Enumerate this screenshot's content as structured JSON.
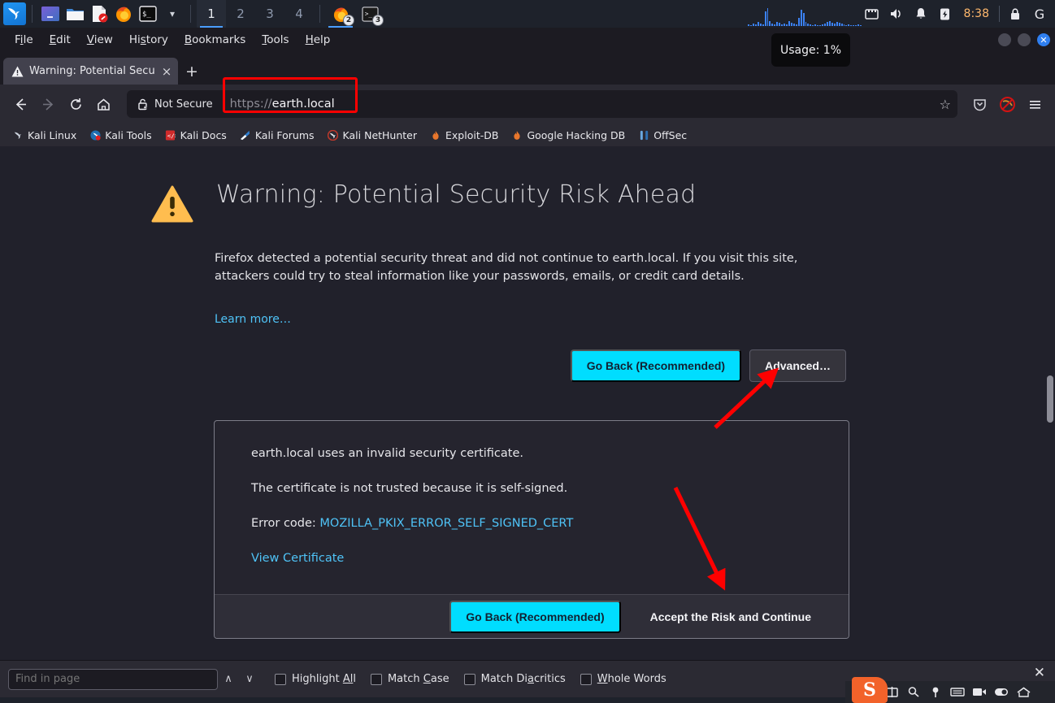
{
  "system_panel": {
    "launcher_icon": "kali-dragon-icon",
    "apps": [
      {
        "name": "app-icon-terminal-emulator",
        "icon": "purple-window-icon"
      },
      {
        "name": "app-icon-file-manager",
        "icon": "folder-icon"
      },
      {
        "name": "app-icon-text-editor",
        "icon": "document-icon"
      },
      {
        "name": "app-icon-firefox",
        "icon": "firefox-icon"
      },
      {
        "name": "app-icon-terminal",
        "icon": "terminal-icon"
      }
    ],
    "app_chevron": "chevron-down-icon",
    "workspaces": [
      "1",
      "2",
      "3",
      "4"
    ],
    "active_workspace": "1",
    "tasks": [
      {
        "name": "taskbar-firefox",
        "icon": "firefox-icon",
        "badge": "2",
        "active": true
      },
      {
        "name": "taskbar-terminal",
        "icon": "terminal-icon",
        "badge": "3",
        "active": false
      }
    ],
    "tray": [
      {
        "name": "network-icon",
        "glyph": "network"
      },
      {
        "name": "volume-icon",
        "glyph": "volume"
      },
      {
        "name": "notification-bell-icon",
        "glyph": "bell"
      },
      {
        "name": "battery-icon",
        "glyph": "battery"
      }
    ],
    "clock": "8:38",
    "lock_icon": "lock-icon",
    "session_icon": "g-icon",
    "network_graph_label": "network-activity-graph"
  },
  "tooltip": {
    "text": "Usage: 1%"
  },
  "browser": {
    "menubar": [
      {
        "name": "menu-file",
        "pre": "F",
        "accel": "i",
        "post": "le"
      },
      {
        "name": "menu-edit",
        "pre": "",
        "accel": "E",
        "post": "dit"
      },
      {
        "name": "menu-view",
        "pre": "",
        "accel": "V",
        "post": "iew"
      },
      {
        "name": "menu-history",
        "pre": "Hi",
        "accel": "s",
        "post": "tory"
      },
      {
        "name": "menu-bookmarks",
        "pre": "",
        "accel": "B",
        "post": "ookmarks"
      },
      {
        "name": "menu-tools",
        "pre": "",
        "accel": "T",
        "post": "ools"
      },
      {
        "name": "menu-help",
        "pre": "",
        "accel": "H",
        "post": "elp"
      }
    ],
    "window_controls": [
      "minimize",
      "maximize",
      "close"
    ],
    "tab": {
      "icon": "warning-triangle-icon",
      "title": "Warning: Potential Security Risk Ahead",
      "close_label": "×"
    },
    "new_tab_label": "+",
    "nav": {
      "back": "←",
      "forward": "→",
      "reload": "⟳",
      "home": "home-icon"
    },
    "urlbar": {
      "security_label": "Not Secure",
      "security_icon": "broken-lock-icon",
      "scheme": "https://",
      "host": "earth.local",
      "full_url": "https://earth.local",
      "bookmark_star": "☆",
      "highlight_color": "#ff0000"
    },
    "toolbar_right": [
      {
        "name": "pocket-icon",
        "glyph": "pocket"
      },
      {
        "name": "no-script-icon",
        "glyph": "noscript"
      },
      {
        "name": "app-menu-button",
        "glyph": "hamburger"
      }
    ],
    "bookmarks": [
      {
        "name": "bookmark-kali-linux",
        "label": "Kali Linux",
        "icon": "kali-dragon-icon",
        "color": "#4a90d9"
      },
      {
        "name": "bookmark-kali-tools",
        "label": "Kali Tools",
        "icon": "tools-icon",
        "color": "#1f6fb2"
      },
      {
        "name": "bookmark-kali-docs",
        "label": "Kali Docs",
        "icon": "docs-icon",
        "color": "#cf2b2b"
      },
      {
        "name": "bookmark-kali-forums",
        "label": "Kali Forums",
        "icon": "forums-icon",
        "color": "#2f7fd0"
      },
      {
        "name": "bookmark-kali-nethunter",
        "label": "Kali NetHunter",
        "icon": "nethunter-icon",
        "color": "#c0392b"
      },
      {
        "name": "bookmark-exploit-db",
        "label": "Exploit-DB",
        "icon": "flame-icon",
        "color": "#e8762c"
      },
      {
        "name": "bookmark-google-hacking-db",
        "label": "Google Hacking DB",
        "icon": "flame-icon",
        "color": "#e8762c"
      },
      {
        "name": "bookmark-offsec",
        "label": "OffSec",
        "icon": "offsec-icon",
        "color": "#4a90d9"
      }
    ]
  },
  "page": {
    "warning_icon": "warning-triangle-icon",
    "title": "Warning: Potential Security Risk Ahead",
    "body": "Firefox detected a potential security threat and did not continue to earth.local. If you visit this site, attackers could try to steal information like your passwords, emails, or credit card details.",
    "learn_more": "Learn more…",
    "go_back_label": "Go Back (Recommended)",
    "advanced_label": "Advanced…",
    "advanced_panel": {
      "line1": "earth.local uses an invalid security certificate.",
      "line2": "The certificate is not trusted because it is self-signed.",
      "error_prefix": "Error code: ",
      "error_code": "MOZILLA_PKIX_ERROR_SELF_SIGNED_CERT",
      "view_certificate": "View Certificate",
      "go_back_label": "Go Back (Recommended)",
      "accept_risk_label": "Accept the Risk and Continue"
    },
    "annotations": [
      {
        "name": "arrow-to-advanced-button",
        "color": "#ff0000",
        "points_to": "Advanced…"
      },
      {
        "name": "arrow-to-accept-risk-button",
        "color": "#ff0000",
        "points_to": "Accept the Risk and Continue"
      }
    ],
    "scrollbar": {
      "name": "vertical-scrollbar",
      "thumb_color": "#8d8d97"
    }
  },
  "findbar": {
    "placeholder": "Find in page",
    "value": "",
    "prev_label": "∧",
    "next_label": "∨",
    "options": [
      {
        "name": "highlight-all-checkbox",
        "pre": "Highlight ",
        "accel": "Al",
        "post": "l",
        "checked": false
      },
      {
        "name": "match-case-checkbox",
        "pre": "Match ",
        "accel": "C",
        "post": "ase",
        "checked": false
      },
      {
        "name": "match-diacritics-checkbox",
        "pre": "Match Di",
        "accel": "a",
        "post": "critics",
        "checked": false
      },
      {
        "name": "whole-words-checkbox",
        "pre": "",
        "accel": "W",
        "post": "hole Words",
        "checked": false
      }
    ],
    "close_label": "✕"
  },
  "dock": {
    "close_label": "✕",
    "logo": "S",
    "icons": [
      {
        "name": "dock-capture-icon",
        "glyph": "capture"
      },
      {
        "name": "dock-magnifier-icon",
        "glyph": "magnifier"
      },
      {
        "name": "dock-pin-icon",
        "glyph": "pin"
      },
      {
        "name": "dock-keyboard-icon",
        "glyph": "keyboard"
      },
      {
        "name": "dock-camera-icon",
        "glyph": "camera"
      },
      {
        "name": "dock-toggle-icon",
        "glyph": "toggle"
      },
      {
        "name": "dock-home-icon",
        "glyph": "home"
      }
    ]
  }
}
